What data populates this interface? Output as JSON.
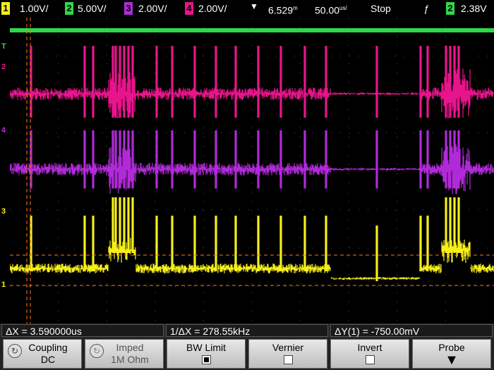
{
  "topbar": {
    "ch1": {
      "num": "1",
      "scale": "1.00V/",
      "color": "#f5ef1a"
    },
    "ch2": {
      "num": "2",
      "scale": "5.00V/",
      "color": "#2ed84a"
    },
    "ch3": {
      "num": "3",
      "scale": "2.00V/",
      "color": "#b12ad9"
    },
    "ch4": {
      "num": "4",
      "scale": "2.00V/",
      "color": "#e8148c"
    },
    "trigger_marker": "▼",
    "delay": "6.529",
    "delay_unit": "m",
    "timebase": "50.00",
    "timebase_unit": "us/",
    "run_state": "Stop",
    "trigger_edge": "ƒ",
    "trigger_source": "2",
    "trigger_level": "2.38V"
  },
  "markers": {
    "t": "T",
    "m2": "2",
    "m4": "4",
    "m3": "3",
    "m1": "1"
  },
  "measurements": {
    "dx": "ΔX = 3.590000us",
    "inv_dx": "1/ΔX = 278.55kHz",
    "dy": "ΔY(1) = -750.00mV"
  },
  "softkeys": {
    "coupling": {
      "label": "Coupling",
      "value": "DC"
    },
    "imped": {
      "label": "Imped",
      "value": "1M Ohm"
    },
    "bwlimit": {
      "label": "BW Limit"
    },
    "vernier": {
      "label": "Vernier"
    },
    "invert": {
      "label": "Invert"
    },
    "probe": {
      "label": "Probe",
      "arrow": "▼"
    }
  },
  "colors": {
    "ch1": "#f5ef1a",
    "ch2": "#2ed84a",
    "ch3": "#b12ad9",
    "ch4": "#e8148c",
    "cursor": "#ff7a1a",
    "grid": "#555555"
  }
}
